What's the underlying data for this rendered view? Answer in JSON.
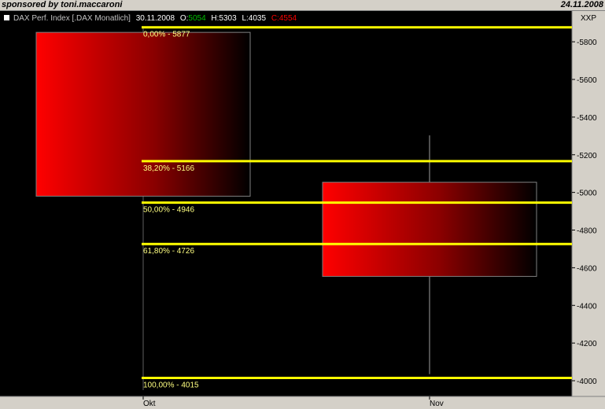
{
  "header": {
    "sponsor": "sponsored by toni.maccaroni",
    "date": "24.11.2008"
  },
  "legend": {
    "name": "DAX Perf. Index [.DAX  Monatlich]",
    "date": "30.11.2008",
    "o_label": "O:",
    "o_value": "5054",
    "h_label": "H:",
    "h_value": "5303",
    "l_label": "L:",
    "l_value": "4035",
    "c_label": "C:",
    "c_value": "4554"
  },
  "chart_data": {
    "type": "candlestick",
    "title": "DAX Perf. Index [.DAX  Monatlich]",
    "currency": "XXP",
    "ylim": [
      3950,
      5930
    ],
    "yticks": [
      4000,
      4200,
      4400,
      4600,
      4800,
      5000,
      5200,
      5400,
      5600,
      5800
    ],
    "xticks": [
      "Okt",
      "Nov"
    ],
    "candles": [
      {
        "period": "Okt",
        "open": 5850,
        "high": 5850,
        "low": 4980,
        "close": 4980
      },
      {
        "period": "Nov",
        "open": 5054,
        "high": 5303,
        "low": 4035,
        "close": 4554
      }
    ],
    "fib_levels": [
      {
        "label": "0,00% - 5877",
        "value": 5877
      },
      {
        "label": "38,20% - 5166",
        "value": 5166
      },
      {
        "label": "50,00% - 4946",
        "value": 4946
      },
      {
        "label": "61,80% - 4726",
        "value": 4726
      },
      {
        "label": "100,00% - 4015",
        "value": 4015
      }
    ],
    "colors": {
      "background": "#000000",
      "fib_line": "#ffff00",
      "fib_text": "#ffff80",
      "candle_start": "#ff0000",
      "candle_end": "#000000",
      "wick": "#a0a0a0",
      "open_value": "#00c000",
      "close_value": "#ff0000"
    }
  }
}
